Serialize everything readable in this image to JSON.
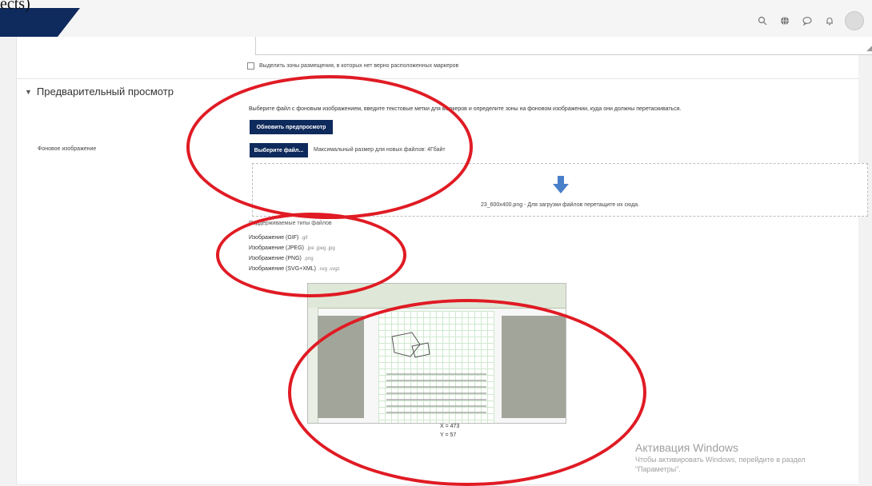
{
  "corner_text": "ects)",
  "header": {
    "icons": [
      "search-icon",
      "globe-icon",
      "chat-icon",
      "bell-icon"
    ],
    "accent_color": "#0f2a5c"
  },
  "form": {
    "checkbox_label": "Выделить зоны размещения, в которых нет верно расположенных маркеров",
    "section_title": "Предварительный просмотр",
    "instruction": "Выберите файл с фоновым изображением, введите текстовые метки для маркеров и определите зоны на фоновом изображении, куда они должны перетаскиваться.",
    "refresh_button": "Обновить предпросмотр",
    "field_label": "Фоновое изображение",
    "choose_button": "Выберите файл...",
    "max_size": "Максимальный размер для новых файлов: 4Гбайт",
    "dropzone_text": "23_600x400.png - Для загрузки файлов перетащите их сюда.",
    "types_heading": "Поддерживаемые типы файлов",
    "types": [
      {
        "label": "Изображение (GIF)",
        "ext": ".gif"
      },
      {
        "label": "Изображение (JPEG)",
        "ext": ".jpe .jpeg .jpg"
      },
      {
        "label": "Изображение (PNG)",
        "ext": ".png"
      },
      {
        "label": "Изображение (SVG+XML)",
        "ext": ".svg .svgz"
      }
    ]
  },
  "preview": {
    "x_readout": "X = 473",
    "y_readout": "Y = 57"
  },
  "windows_activation": {
    "title": "Активация Windows",
    "line1": "Чтобы активировать Windows, перейдите в раздел",
    "line2": "\"Параметры\"."
  },
  "annotation_color": "#e01b24"
}
